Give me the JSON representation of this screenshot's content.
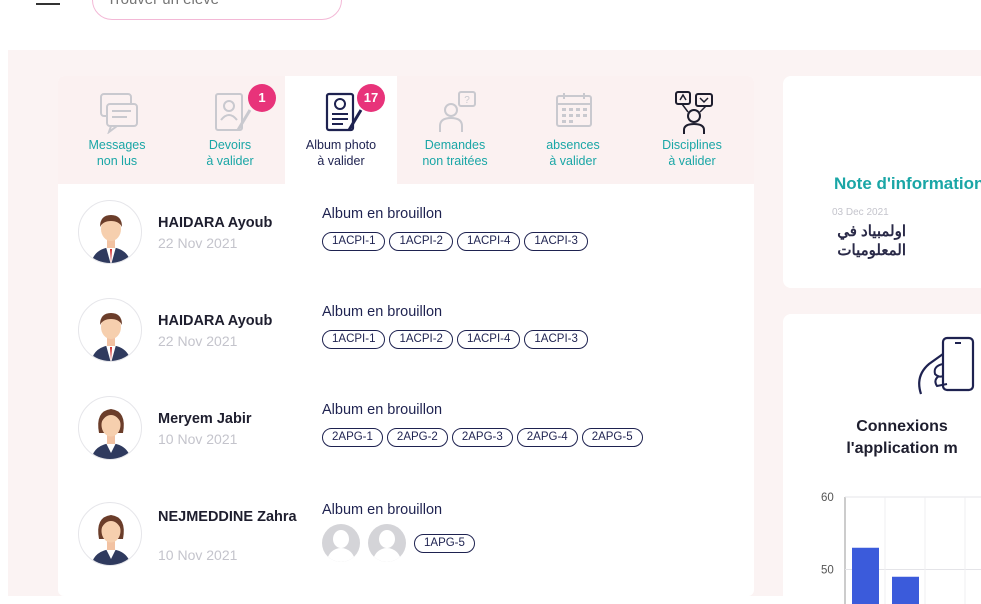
{
  "search": {
    "placeholder": "Trouver un élève"
  },
  "tabs": [
    {
      "label1": "Messages",
      "label2": "non lus",
      "icon": "messages-icon"
    },
    {
      "label1": "Devoirs",
      "label2": "à valider",
      "icon": "homework-icon",
      "badge": "1"
    },
    {
      "label1": "Album photo",
      "label2": "à valider",
      "icon": "photo-album-icon",
      "badge": "17"
    },
    {
      "label1": "Demandes",
      "label2": "non traitées",
      "icon": "requests-icon"
    },
    {
      "label1": "absences",
      "label2": "à valider",
      "icon": "calendar-icon"
    },
    {
      "label1": "Disciplines",
      "label2": "à valider",
      "icon": "discipline-icon"
    }
  ],
  "rows": [
    {
      "name": "HAIDARA Ayoub",
      "date": "22 Nov 2021",
      "status": "Album en brouillon",
      "tags": [
        "1ACPI-1",
        "1ACPI-2",
        "1ACPI-4",
        "1ACPI-3"
      ],
      "avatar": "male"
    },
    {
      "name": "HAIDARA Ayoub",
      "date": "22 Nov 2021",
      "status": "Album en brouillon",
      "tags": [
        "1ACPI-1",
        "1ACPI-2",
        "1ACPI-4",
        "1ACPI-3"
      ],
      "avatar": "male"
    },
    {
      "name": "Meryem Jabir",
      "date": "10 Nov 2021",
      "status": "Album en brouillon",
      "tags": [
        "2APG-1",
        "2APG-2",
        "2APG-3",
        "2APG-4",
        "2APG-5"
      ],
      "avatar": "female"
    },
    {
      "name": "NEJMEDDINE Zahra",
      "date": "10 Nov 2021",
      "status": "Album en brouillon",
      "tags": [
        "1APG-5"
      ],
      "avatar": "female",
      "ghosts": 2
    }
  ],
  "note": {
    "title": "Note d'information",
    "date": "03 Dec 2021",
    "text": "اولمبياد في المعلوميات"
  },
  "connexions": {
    "title_line1": "Connexions",
    "title_line2": "l'application m"
  },
  "chart_data": {
    "type": "bar",
    "yticks": [
      "60",
      "50"
    ],
    "values": [
      53,
      49
    ]
  },
  "colors": {
    "accent": "#1aa6a6",
    "badge": "#e8337a",
    "navy": "#1e2250",
    "bar": "#3b5bdb"
  }
}
